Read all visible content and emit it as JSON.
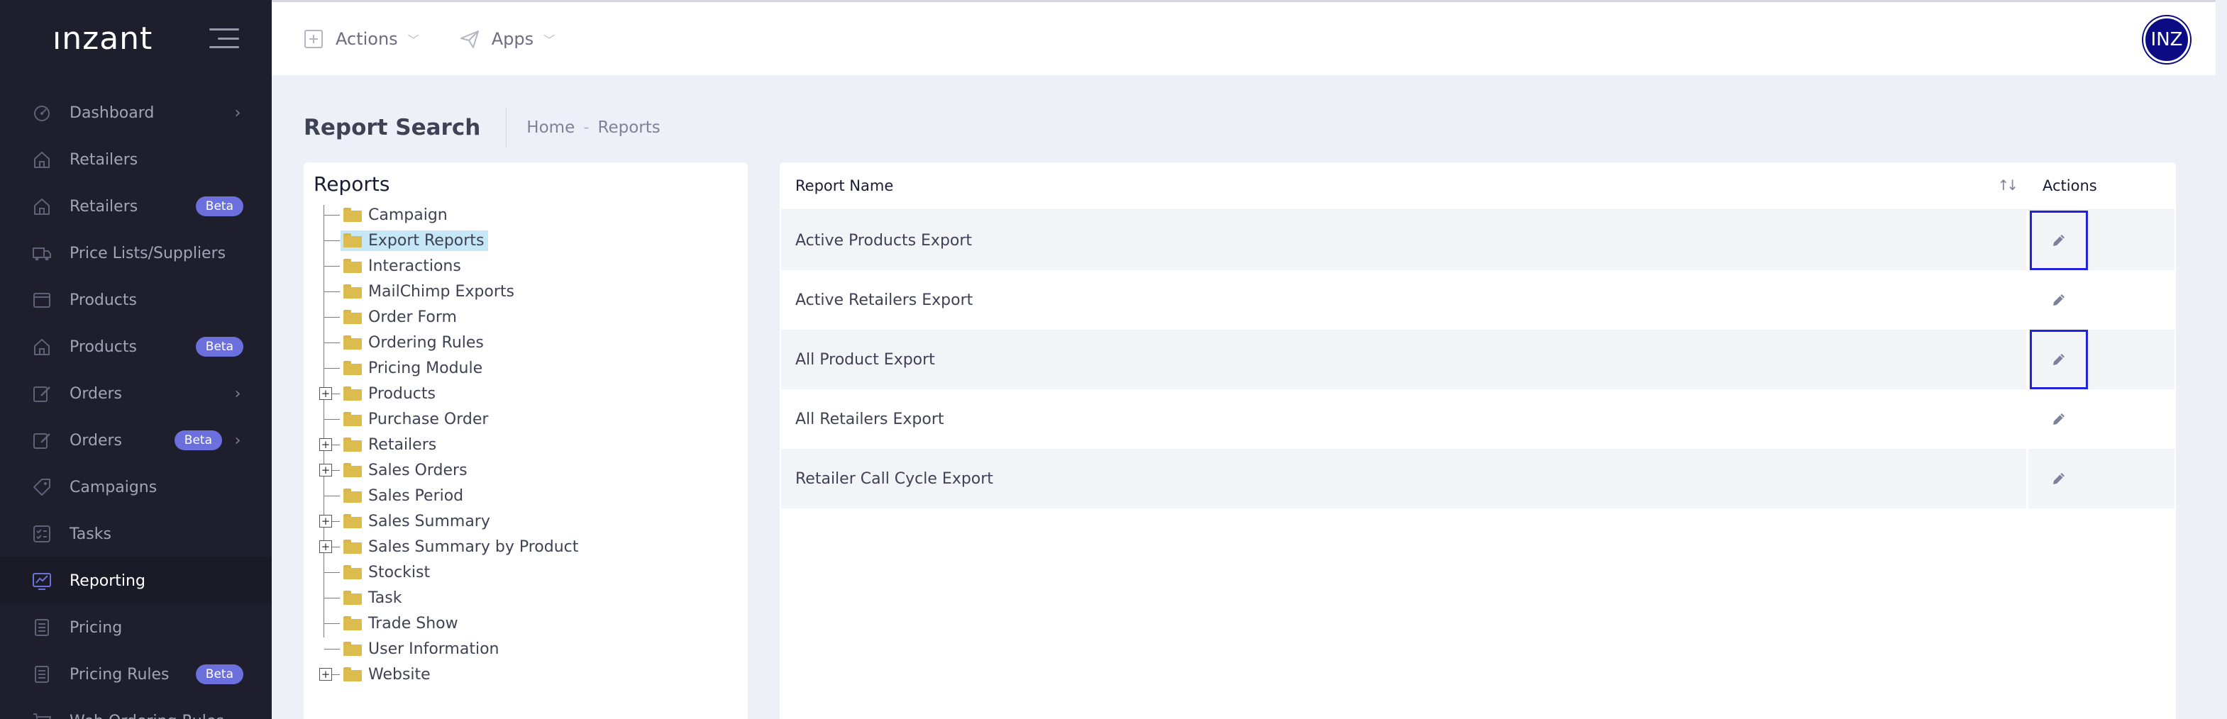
{
  "brand": {
    "logo": "ınzant"
  },
  "sidebar": {
    "items": [
      {
        "label": "Dashboard",
        "icon": "dashboard-icon",
        "badge": "",
        "chevron": true,
        "active": false
      },
      {
        "label": "Retailers",
        "icon": "home-icon",
        "badge": "",
        "chevron": false,
        "active": false
      },
      {
        "label": "Retailers",
        "icon": "home-icon",
        "badge": "Beta",
        "chevron": false,
        "active": false
      },
      {
        "label": "Price Lists/Suppliers",
        "icon": "truck-icon",
        "badge": "",
        "chevron": false,
        "active": false
      },
      {
        "label": "Products",
        "icon": "box-icon",
        "badge": "",
        "chevron": false,
        "active": false
      },
      {
        "label": "Products",
        "icon": "home-icon",
        "badge": "Beta",
        "chevron": false,
        "active": false
      },
      {
        "label": "Orders",
        "icon": "edit-doc-icon",
        "badge": "",
        "chevron": true,
        "active": false
      },
      {
        "label": "Orders",
        "icon": "edit-doc-icon",
        "badge": "Beta",
        "chevron": true,
        "active": false
      },
      {
        "label": "Campaigns",
        "icon": "tag-icon",
        "badge": "",
        "chevron": false,
        "active": false
      },
      {
        "label": "Tasks",
        "icon": "tasks-icon",
        "badge": "",
        "chevron": false,
        "active": false
      },
      {
        "label": "Reporting",
        "icon": "chart-icon",
        "badge": "",
        "chevron": false,
        "active": true
      },
      {
        "label": "Pricing",
        "icon": "stack-icon",
        "badge": "",
        "chevron": false,
        "active": false
      },
      {
        "label": "Pricing Rules",
        "icon": "stack-icon",
        "badge": "Beta",
        "chevron": false,
        "active": false
      },
      {
        "label": "Web Ordering Rules",
        "icon": "cart-icon",
        "badge": "",
        "chevron": false,
        "active": false
      }
    ]
  },
  "header": {
    "actions_label": "Actions",
    "apps_label": "Apps",
    "avatar_initials": "INZ"
  },
  "subheader": {
    "title": "Report Search",
    "breadcrumb": [
      "Home",
      "Reports"
    ],
    "separator": "-"
  },
  "tree": {
    "title": "Reports",
    "expand_symbol": "+",
    "nodes": [
      {
        "label": "Campaign",
        "expandable": false,
        "selected": false
      },
      {
        "label": "Export Reports",
        "expandable": false,
        "selected": true
      },
      {
        "label": "Interactions",
        "expandable": false,
        "selected": false
      },
      {
        "label": "MailChimp Exports",
        "expandable": false,
        "selected": false
      },
      {
        "label": "Order Form",
        "expandable": false,
        "selected": false
      },
      {
        "label": "Ordering Rules",
        "expandable": false,
        "selected": false
      },
      {
        "label": "Pricing Module",
        "expandable": false,
        "selected": false
      },
      {
        "label": "Products",
        "expandable": true,
        "selected": false
      },
      {
        "label": "Purchase Order",
        "expandable": false,
        "selected": false
      },
      {
        "label": "Retailers",
        "expandable": true,
        "selected": false
      },
      {
        "label": "Sales Orders",
        "expandable": true,
        "selected": false
      },
      {
        "label": "Sales Period",
        "expandable": false,
        "selected": false
      },
      {
        "label": "Sales Summary",
        "expandable": true,
        "selected": false
      },
      {
        "label": "Sales Summary by Product",
        "expandable": true,
        "selected": false
      },
      {
        "label": "Stockist",
        "expandable": false,
        "selected": false
      },
      {
        "label": "Task",
        "expandable": false,
        "selected": false
      },
      {
        "label": "Trade Show",
        "expandable": false,
        "selected": false
      },
      {
        "label": "User Information",
        "expandable": false,
        "selected": false
      },
      {
        "label": "Website",
        "expandable": true,
        "selected": false
      }
    ]
  },
  "table": {
    "columns": [
      "Report Name",
      "Actions"
    ],
    "sort_symbol": "↑↓",
    "rows": [
      {
        "name": "Active Products Export",
        "highlight": true
      },
      {
        "name": "Active Retailers Export",
        "highlight": false
      },
      {
        "name": "All Product Export",
        "highlight": true
      },
      {
        "name": "All Retailers Export",
        "highlight": false
      },
      {
        "name": "Retailer Call Cycle Export",
        "highlight": false
      }
    ]
  },
  "colors": {
    "sidebar_bg": "#1e1e2d",
    "badge": "#6c70dc",
    "avatar": "#0b0b84",
    "selection": "#c6e7f7",
    "folder": "#dcbb4f",
    "highlight_border": "#2222dd"
  }
}
